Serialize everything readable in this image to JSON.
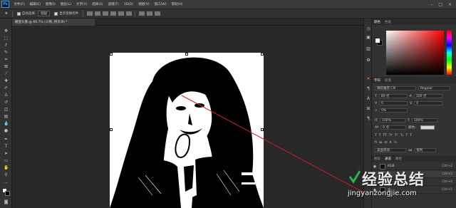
{
  "menubar": {
    "logo": "Ps",
    "items": [
      "文件(F)",
      "编辑(E)",
      "图像(I)",
      "图层(L)",
      "文字(Y)",
      "选择(S)",
      "滤镜(T)",
      "3D(D)",
      "视图(V)",
      "窗口(W)",
      "帮助(H)"
    ]
  },
  "options": {
    "auto_select_label": "自动选择：",
    "auto_select_value": "图层",
    "show_transform_label": "显示变换控件"
  },
  "document": {
    "tab_title": "鳝变头像 @ 66.7% (人物, 拷贝/8) *"
  },
  "panels": {
    "color_tabs": [
      "颜色",
      "色板"
    ],
    "character_tabs": [
      "字符",
      "段落"
    ],
    "channels_tabs": [
      "图层",
      "通道",
      "路径"
    ],
    "font_family": "微软雅黑 CN",
    "font_style": "Regular",
    "font_size": "80 点",
    "leading": "100 点",
    "kerning": "0",
    "tracking": "0",
    "scale_pct": "0%",
    "vscale": "100%",
    "hscale": "100%",
    "baseline": "0 点",
    "color_label": "颜色：",
    "language": "美国英语",
    "aa": "锐利",
    "channels": [
      {
        "name": "RGB",
        "key": "Ctrl+2",
        "selected": false
      },
      {
        "name": "红",
        "key": "Ctrl+3",
        "selected": true
      },
      {
        "name": "绿",
        "key": "Ctrl+4",
        "selected": false
      },
      {
        "name": "蓝",
        "key": "Ctrl+5",
        "selected": false
      }
    ]
  },
  "watermark": {
    "main": "经验总结",
    "url": "jingyanzongjie.com"
  }
}
